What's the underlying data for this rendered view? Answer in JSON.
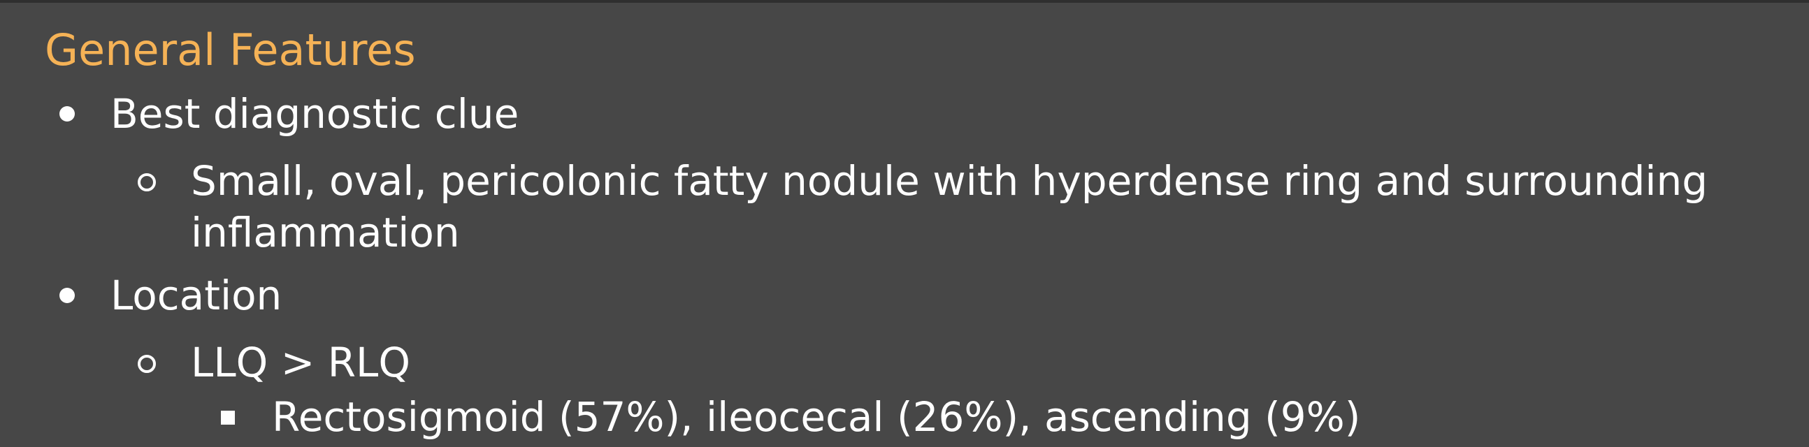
{
  "slide": {
    "title": "General Features",
    "items": [
      {
        "label": "Best diagnostic clue",
        "sub": [
          {
            "line1": "Small, oval, pericolonic fatty nodule with hyperdense ring and surrounding",
            "line2": "inflammation"
          }
        ]
      },
      {
        "label": "Location",
        "sub": [
          {
            "label": "LLQ > RLQ",
            "sub": [
              {
                "label": "Rectosigmoid (57%), ileocecal (26%), ascending (9%)"
              }
            ]
          }
        ]
      }
    ]
  }
}
